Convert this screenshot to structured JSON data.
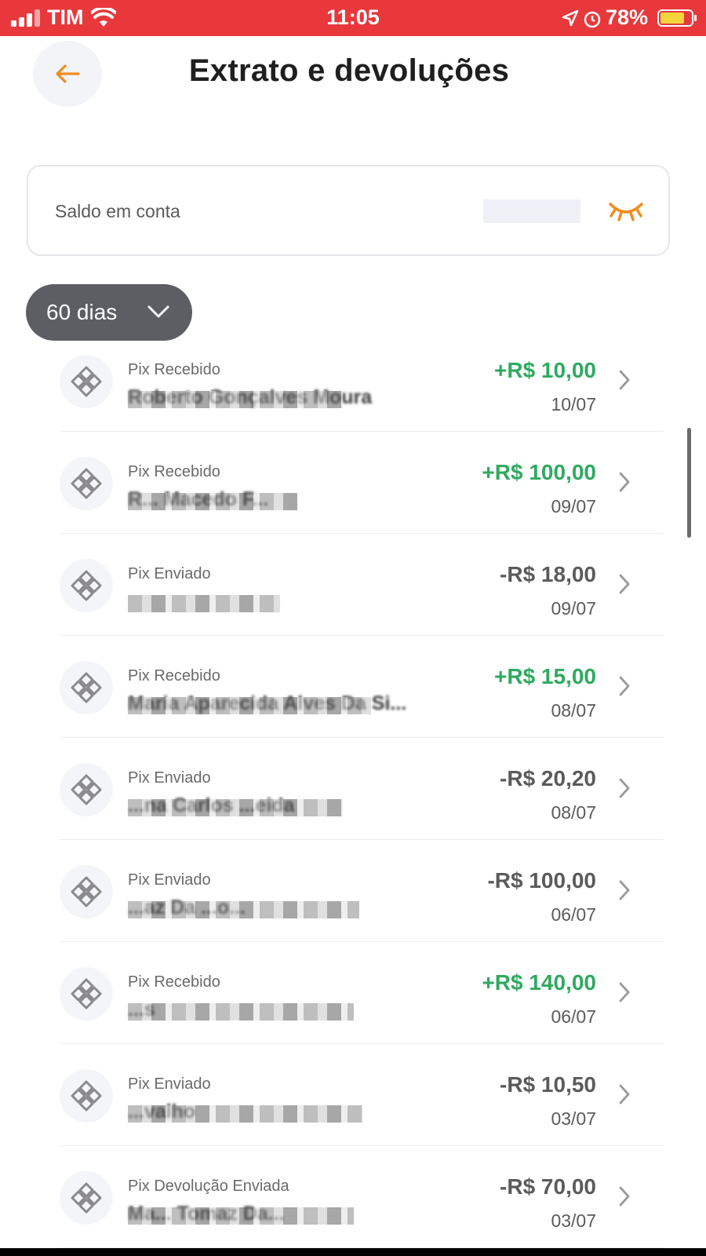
{
  "status_bar": {
    "carrier": "TIM",
    "time": "11:05",
    "battery": "78%",
    "colors": {
      "background": "#e8383c",
      "battery_fill": "#f3d43a"
    },
    "icons": [
      "signal-icon",
      "wifi-icon",
      "location-icon",
      "alarm-icon",
      "battery-icon"
    ]
  },
  "header": {
    "back_icon": "arrow-left-icon",
    "title": "Extrato e devoluções"
  },
  "balance": {
    "label": "Saldo em conta",
    "value_hidden": true,
    "toggle_icon": "eye-closed-icon"
  },
  "filter": {
    "selected": "60 dias",
    "icon": "chevron-down-icon"
  },
  "colors": {
    "accent": "#f08c1f",
    "credit": "#2faa60",
    "debit": "#5b5b5b"
  },
  "transactions": [
    {
      "type": "Pix Recebido",
      "name": "Roberto Gonçalves Moura",
      "amount": "+R$ 10,00",
      "date": "10/07",
      "direction": "in"
    },
    {
      "type": "Pix Recebido",
      "name": "R... Macedo F...",
      "amount": "+R$ 100,00",
      "date": "09/07",
      "direction": "in"
    },
    {
      "type": "Pix Enviado",
      "name": "",
      "amount": "-R$ 18,00",
      "date": "09/07",
      "direction": "out"
    },
    {
      "type": "Pix Recebido",
      "name": "Maria Aparecida Alves Da Si...",
      "amount": "+R$ 15,00",
      "date": "08/07",
      "direction": "in"
    },
    {
      "type": "Pix Enviado",
      "name": "...na Carlos ...eida",
      "amount": "-R$ 20,20",
      "date": "08/07",
      "direction": "out"
    },
    {
      "type": "Pix Enviado",
      "name": "...az Da ...o...",
      "amount": "-R$ 100,00",
      "date": "06/07",
      "direction": "out"
    },
    {
      "type": "Pix Recebido",
      "name": "...s",
      "amount": "+R$ 140,00",
      "date": "06/07",
      "direction": "in"
    },
    {
      "type": "Pix Enviado",
      "name": "...valho",
      "amount": "-R$ 10,50",
      "date": "03/07",
      "direction": "out"
    },
    {
      "type": "Pix Devolução Enviada",
      "name": "Ma... Tomaz Da...",
      "amount": "-R$ 70,00",
      "date": "03/07",
      "direction": "out"
    }
  ]
}
